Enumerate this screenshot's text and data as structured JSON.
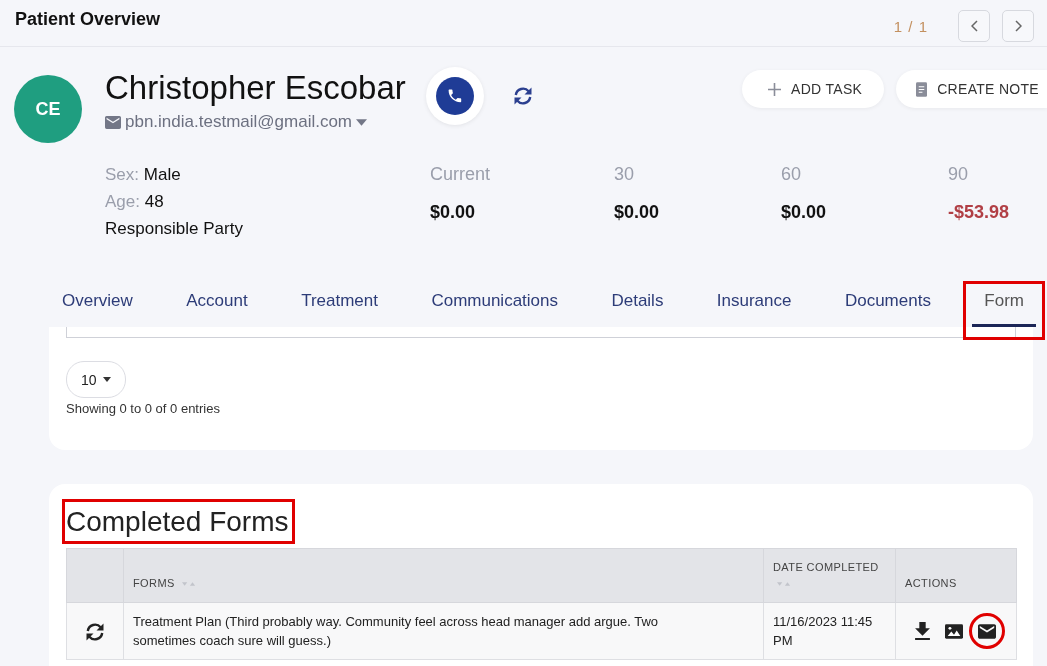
{
  "header": {
    "title": "Patient Overview",
    "pager": "1 / 1"
  },
  "patient": {
    "initials": "CE",
    "name": "Christopher Escobar",
    "email": "pbn.india.testmail@gmail.com",
    "details": [
      {
        "label": "Sex:",
        "value": "Male"
      },
      {
        "label": "Age:",
        "value": "48"
      },
      {
        "value": "Responsible Party"
      }
    ]
  },
  "actions": [
    {
      "kind": "add",
      "label": "ADD TASK"
    },
    {
      "kind": "note",
      "label": "CREATE NOTE"
    }
  ],
  "aging": [
    {
      "label": "Current",
      "amount": "$0.00",
      "negative": false
    },
    {
      "label": "30",
      "amount": "$0.00",
      "negative": false
    },
    {
      "label": "60",
      "amount": "$0.00",
      "negative": false
    },
    {
      "label": "90",
      "amount": "-$53.98",
      "negative": true
    }
  ],
  "tabs": [
    {
      "label": "Overview",
      "selected": false,
      "highlighted": false
    },
    {
      "label": "Account",
      "selected": false,
      "highlighted": false
    },
    {
      "label": "Treatment",
      "selected": false,
      "highlighted": false
    },
    {
      "label": "Communications",
      "selected": false,
      "highlighted": false
    },
    {
      "label": "Details",
      "selected": false,
      "highlighted": false
    },
    {
      "label": "Insurance",
      "selected": false,
      "highlighted": false
    },
    {
      "label": "Documents",
      "selected": false,
      "highlighted": false
    },
    {
      "label": "Form",
      "selected": true,
      "highlighted": true
    }
  ],
  "forms_list": {
    "page_length": "10",
    "info": "Showing 0 to 0 of 0 entries"
  },
  "completed_forms": {
    "title": "Completed Forms",
    "title_highlighted": true,
    "columns": [
      {
        "label": "FORMS",
        "sortable": true
      },
      {
        "label": "DATE COMPLETED",
        "sortable": true
      },
      {
        "label": "ACTIONS",
        "sortable": false
      }
    ],
    "rows": [
      {
        "form": "Treatment Plan (Third probably way. Community feel across head manager add argue. Two sometimes coach sure will guess.)",
        "date": "11/16/2023 11:45 PM",
        "actions": [
          {
            "kind": "download",
            "highlighted": false
          },
          {
            "kind": "image",
            "highlighted": false
          },
          {
            "kind": "email",
            "highlighted": true
          }
        ]
      }
    ]
  }
}
